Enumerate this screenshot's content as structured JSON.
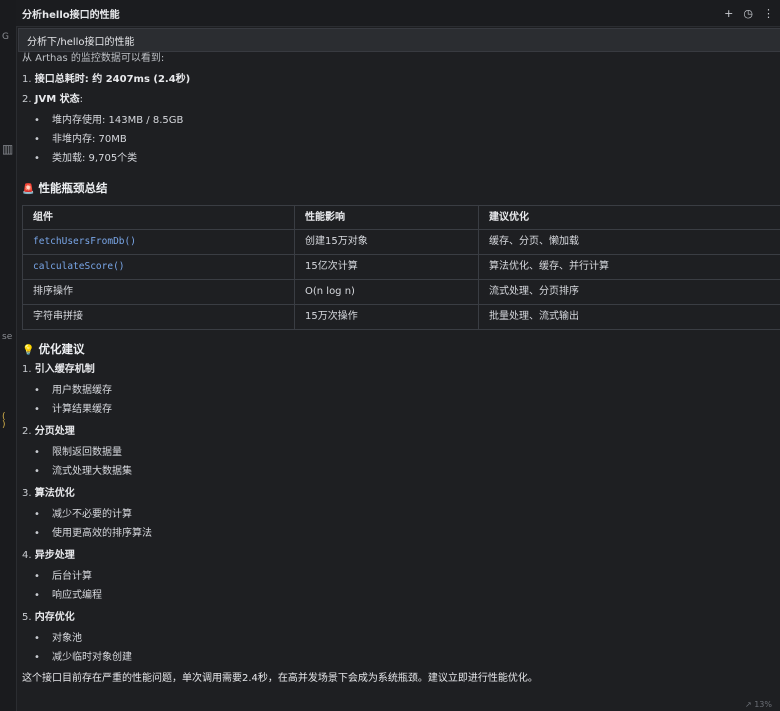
{
  "window": {
    "title": "分析hello接口的性能",
    "actions": {
      "add": "+",
      "history": "◷",
      "more": "⋮"
    }
  },
  "gutter": {
    "marks": [
      "G",
      "se",
      "(",
      ")"
    ]
  },
  "query": {
    "text": "分析下/hello接口的性能"
  },
  "intro": {
    "text": "从 Arthas 的监控数据可以看到:"
  },
  "metrics": {
    "item1": {
      "num": "1.",
      "label": "接口总耗时",
      "value": ": 约 2407ms (2.4秒)"
    },
    "item2": {
      "num": "2.",
      "label": "JVM 状态",
      "colon": ":"
    },
    "jvm": [
      "堆内存使用: 143MB / 8.5GB",
      "非堆内存: 70MB",
      "类加载: 9,705个类"
    ]
  },
  "summary": {
    "heading": "性能瓶颈总结",
    "icon": "🚨",
    "headers": [
      "组件",
      "性能影响",
      "建议优化"
    ],
    "rows": [
      [
        "fetchUsersFromDb()",
        "创建15万对象",
        "缓存、分页、懒加载"
      ],
      [
        "calculateScore()",
        "15亿次计算",
        "算法优化、缓存、并行计算"
      ],
      [
        "排序操作",
        "O(n log n)",
        "流式处理、分页排序"
      ],
      [
        "字符串拼接",
        "15万次操作",
        "批量处理、流式输出"
      ]
    ]
  },
  "advice": {
    "heading": "优化建议",
    "icon": "💡",
    "items": [
      {
        "num": "1.",
        "title": "引入缓存机制",
        "subs": [
          "用户数据缓存",
          "计算结果缓存"
        ]
      },
      {
        "num": "2.",
        "title": "分页处理",
        "subs": [
          "限制返回数据量",
          "流式处理大数据集"
        ]
      },
      {
        "num": "3.",
        "title": "算法优化",
        "subs": [
          "减少不必要的计算",
          "使用更高效的排序算法"
        ]
      },
      {
        "num": "4.",
        "title": "异步处理",
        "subs": [
          "后台计算",
          "响应式编程"
        ]
      },
      {
        "num": "5.",
        "title": "内存优化",
        "subs": [
          "对象池",
          "减少临时对象创建"
        ]
      }
    ]
  },
  "conclusion": {
    "text": "这个接口目前存在严重的性能问题，单次调用需要2.4秒，在高并发场景下会成为系统瓶颈。建议立即进行性能优化。"
  },
  "status": {
    "text": "↗ 13%"
  },
  "colors": {
    "background": "#1e1f22",
    "code": "#79a6e8",
    "border": "#3a3d43"
  }
}
